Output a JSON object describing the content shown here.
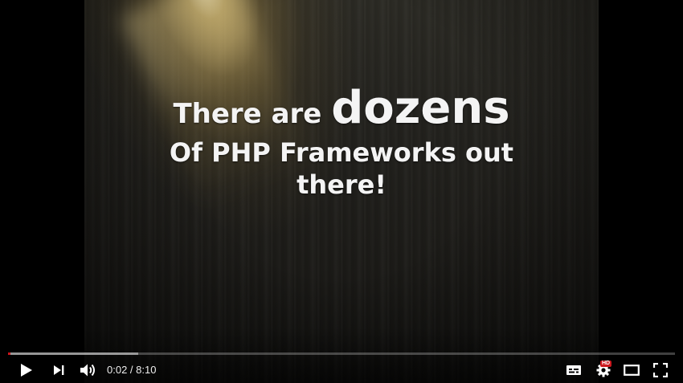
{
  "slide": {
    "line1_prefix": "There are ",
    "line1_emphasis": "dozens",
    "line2": "Of PHP Frameworks out",
    "line3": "there!"
  },
  "player": {
    "current_time": "0:02",
    "duration": "8:10",
    "time_separator": " / ",
    "played_fraction": 0.004,
    "buffered_fraction": 0.195,
    "quality_badge": "HD",
    "accent_color": "#cc181e"
  },
  "icons": {
    "play": "play-icon",
    "next": "next-icon",
    "volume": "volume-icon",
    "captions": "captions-icon",
    "settings": "settings-icon",
    "theater": "theater-mode-icon",
    "fullscreen": "fullscreen-icon"
  }
}
